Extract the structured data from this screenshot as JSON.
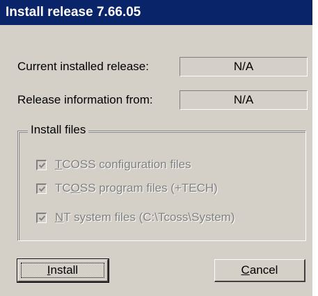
{
  "window": {
    "title": "Install release 7.66.05"
  },
  "info": {
    "current_label": "Current installed release:",
    "current_value": "N/A",
    "source_label": "Release information from:",
    "source_value": "N/A"
  },
  "install_files": {
    "group_label": "Install files",
    "options": [
      {
        "mnemonic": "T",
        "rest": "COSS configuration files",
        "checked": true,
        "enabled": false
      },
      {
        "pre": "TC",
        "mnemonic": "O",
        "rest": "SS program files (+TECH)",
        "checked": true,
        "enabled": false
      },
      {
        "mnemonic": "N",
        "rest": "T system files (C:\\Tcoss\\System)",
        "checked": true,
        "enabled": false
      }
    ]
  },
  "buttons": {
    "install_mnemonic": "I",
    "install_rest": "nstall",
    "cancel_mnemonic": "C",
    "cancel_rest": "ancel"
  }
}
